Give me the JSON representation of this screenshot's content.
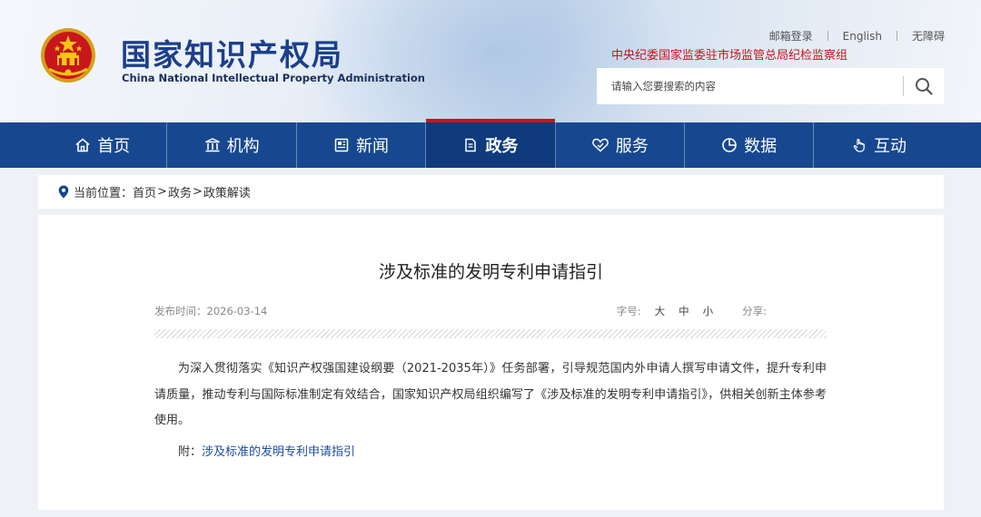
{
  "header": {
    "logo_cn": "国家知识产权局",
    "logo_en": "China National Intellectual Property Administration",
    "links": [
      "邮箱登录",
      "English",
      "无障碍"
    ],
    "supervise_text": "中央纪委国家监委驻市场监管总局纪检监察组",
    "search_placeholder": "请输入您要搜索的内容"
  },
  "nav": {
    "items": [
      {
        "label": "首页",
        "icon": "home-icon"
      },
      {
        "label": "机构",
        "icon": "institution-icon"
      },
      {
        "label": "新闻",
        "icon": "news-icon"
      },
      {
        "label": "政务",
        "icon": "government-affairs-icon",
        "active": true
      },
      {
        "label": "服务",
        "icon": "service-icon"
      },
      {
        "label": "数据",
        "icon": "data-chart-icon"
      },
      {
        "label": "互动",
        "icon": "interaction-hand-icon"
      }
    ]
  },
  "breadcrumb": {
    "prefix": "当前位置：",
    "items": [
      "首页",
      "政务",
      "政策解读"
    ],
    "separator": ">"
  },
  "article": {
    "title": "涉及标准的发明专利申请指引",
    "date_label": "发布时间：",
    "date": "2026-03-14",
    "font_size_label": "字号:",
    "font_sizes": [
      "大",
      "中",
      "小"
    ],
    "share_label": "分享:",
    "body": "为深入贯彻落实《知识产权强国建设纲要（2021-2035年）》任务部署，引导规范国内外申请人撰写申请文件，提升专利申请质量，推动专利与国际标准制定有效结合，国家知识产权局组织编写了《涉及标准的发明专利申请指引》，供相关创新主体参考使用。",
    "attachment_label": "附：",
    "attachment_link": "涉及标准的发明专利申请指引"
  },
  "colors": {
    "nav_bg": "#17488f",
    "nav_active": "#0f3b7d",
    "accent_red": "#c8161d",
    "logo_blue": "#1b3f8b",
    "link_blue": "#1b4da0"
  }
}
